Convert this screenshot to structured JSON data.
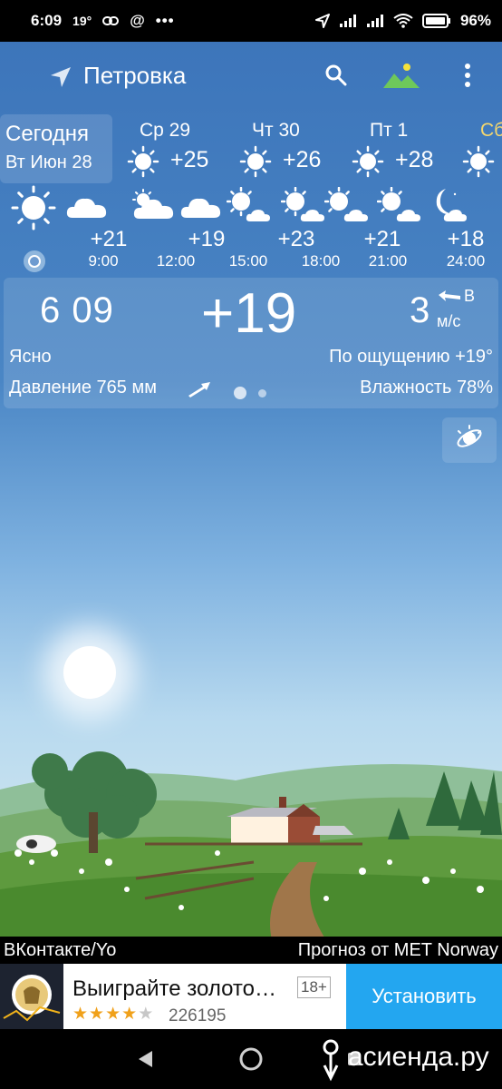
{
  "status_bar": {
    "time": "6:09",
    "temp": "19°",
    "battery": "96%"
  },
  "toolbar": {
    "location": "Петровка"
  },
  "days": [
    {
      "line1": "Сегодня",
      "line2": "Вт Июн 28"
    },
    {
      "name": "Ср 29",
      "temp": "+25"
    },
    {
      "name": "Чт 30",
      "temp": "+26"
    },
    {
      "name": "Пт 1",
      "temp": "+28"
    },
    {
      "name": "Сб",
      "temp": ""
    }
  ],
  "hours": [
    {
      "temp": "+21",
      "time": "9:00",
      "icon": "cloud-icon"
    },
    {
      "temp": "+19",
      "time": "12:00",
      "icon": "sun-cloud-icon"
    },
    {
      "temp": "+23",
      "time": "15:00",
      "icon": "sun-cloud-icon"
    },
    {
      "temp": "+21",
      "time": "18:00",
      "icon": "sun-cloud-icon"
    },
    {
      "temp": "+18",
      "time": "21:00",
      "icon": "sun-cloud-icon"
    },
    {
      "temp": "",
      "time": "24:00",
      "icon": "moon-cloud-icon"
    }
  ],
  "hour_temps_shown": [
    "+21",
    "+19",
    "+23",
    "+21",
    "+18"
  ],
  "current": {
    "time": "6 09",
    "temp": "+19",
    "wind_speed": "3",
    "wind_dir": "В",
    "wind_unit": "м/с",
    "condition": "Ясно",
    "feels_like": "По ощущению +19°",
    "pressure": "Давление 765 мм",
    "humidity": "Влажность 78%",
    "page_index": 1,
    "page_count": 2
  },
  "source": {
    "left": "ВКонтакте/Yo",
    "right": "Прогноз от MET Norway"
  },
  "ad": {
    "title": "Выиграйте золото…",
    "age": "18+",
    "rating": 4,
    "rating_max": 5,
    "reviews": "226195",
    "install": "Установить"
  },
  "watermark": "асиенда.ру",
  "colors": {
    "sky_top": "#3b73b9",
    "ad_button": "#23a6f0",
    "star": "#f0a11b"
  }
}
